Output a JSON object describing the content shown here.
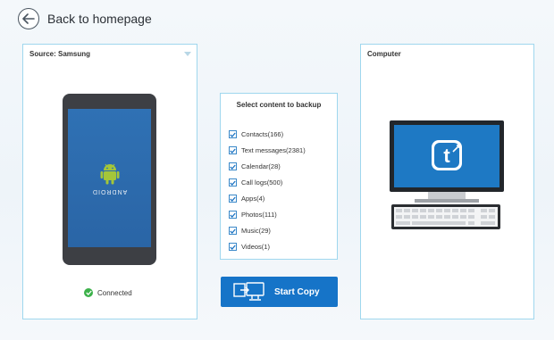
{
  "header": {
    "back_label": "Back to homepage"
  },
  "source": {
    "title": "Source: Samsung",
    "device_logo_text": "ANDROID",
    "status": "Connected",
    "status_color": "#3cb14a"
  },
  "destination": {
    "title": "Computer"
  },
  "content_select": {
    "title": "Select content to backup",
    "items": [
      {
        "label": "Contacts(166)",
        "checked": true
      },
      {
        "label": "Text messages(2381)",
        "checked": true
      },
      {
        "label": "Calendar(28)",
        "checked": true
      },
      {
        "label": "Call logs(500)",
        "checked": true
      },
      {
        "label": "Apps(4)",
        "checked": true
      },
      {
        "label": "Photos(111)",
        "checked": true
      },
      {
        "label": "Music(29)",
        "checked": true
      },
      {
        "label": "Videos(1)",
        "checked": true
      }
    ]
  },
  "actions": {
    "start_copy_label": "Start Copy"
  },
  "colors": {
    "accent": "#1674c8",
    "panel_border": "#9fd7ee"
  }
}
